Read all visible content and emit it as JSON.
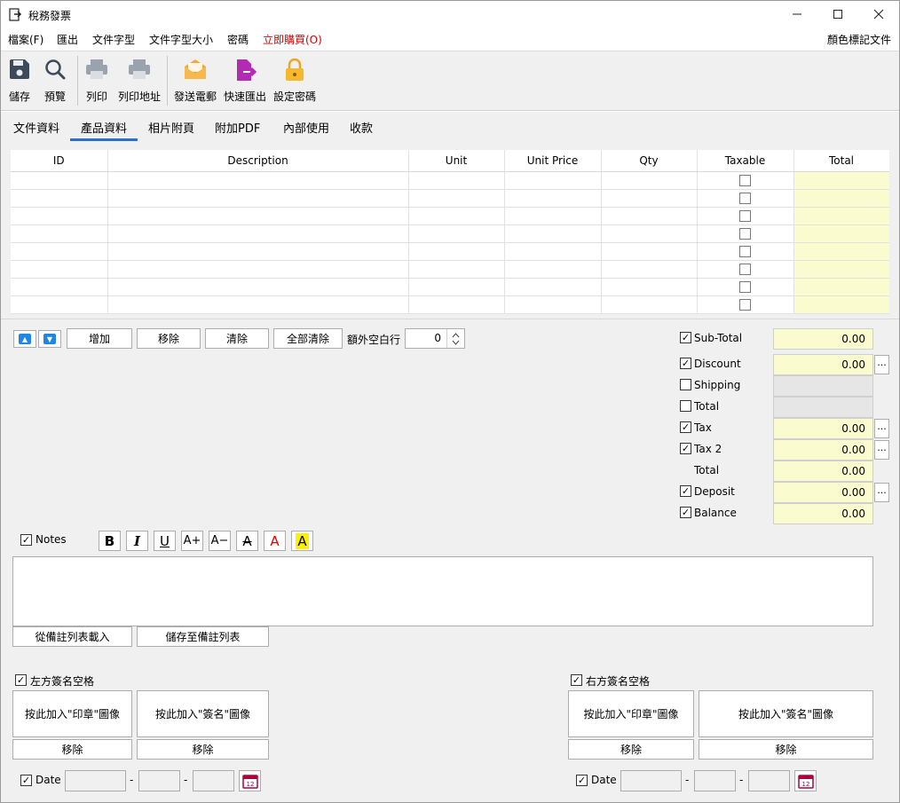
{
  "window": {
    "title": "稅務發票",
    "minimize": "—",
    "maximize": "☐",
    "close": "✕"
  },
  "menu": {
    "items": [
      "檔案(F)",
      "匯出",
      "文件字型",
      "文件字型大小",
      "密碼"
    ],
    "buy": "立即購買(O)",
    "right": "顏色標記文件"
  },
  "toolbar": {
    "save": "儲存",
    "preview": "預覽",
    "print": "列印",
    "print_address": "列印地址",
    "send_email": "發送電郵",
    "quick_export": "快速匯出",
    "set_password": "設定密碼"
  },
  "tabs": [
    "文件資料",
    "產品資料",
    "相片附頁",
    "附加PDF",
    "內部使用",
    "收款"
  ],
  "grid": {
    "columns": [
      "ID",
      "Description",
      "Unit",
      "Unit Price",
      "Qty",
      "Taxable",
      "Total"
    ],
    "row_count": 8
  },
  "row_controls": {
    "add": "增加",
    "remove": "移除",
    "clear": "清除",
    "clear_all": "全部清除",
    "extra_blank_rows": "額外空白行",
    "extra_blank_rows_value": "0"
  },
  "summary": {
    "subtotal": {
      "label": "Sub-Total",
      "value": "0.00",
      "checked": true
    },
    "discount": {
      "label": "Discount",
      "value": "0.00",
      "checked": true
    },
    "shipping": {
      "label": "Shipping",
      "value": "",
      "checked": false
    },
    "total1": {
      "label": "Total",
      "value": "",
      "checked": false
    },
    "tax": {
      "label": "Tax",
      "value": "0.00",
      "checked": true
    },
    "tax2": {
      "label": "Tax 2",
      "value": "0.00",
      "checked": true
    },
    "total2": {
      "label": "Total",
      "value": "0.00"
    },
    "deposit": {
      "label": "Deposit",
      "value": "0.00",
      "checked": true
    },
    "balance": {
      "label": "Balance",
      "value": "0.00",
      "checked": true
    },
    "more": "..."
  },
  "notes": {
    "label": "Notes",
    "load": "從備註列表載入",
    "save": "儲存至備註列表",
    "format": [
      "B",
      "I",
      "U",
      "A+",
      "A−",
      "A",
      "A",
      "A"
    ]
  },
  "signature_left": {
    "label": "左方簽名空格",
    "stamp": "按此加入\"印章\"圖像",
    "sign": "按此加入\"簽名\"圖像",
    "remove": "移除",
    "date_label": "Date"
  },
  "signature_right": {
    "label": "右方簽名空格",
    "stamp": "按此加入\"印章\"圖像",
    "sign": "按此加入\"簽名\"圖像",
    "remove": "移除",
    "date_label": "Date"
  },
  "date_sep": "-",
  "calendar_day": "12",
  "colors": {
    "accent": "#2a6fc9",
    "total_bg": "#fbfbd0",
    "buy_red": "#d40000"
  }
}
